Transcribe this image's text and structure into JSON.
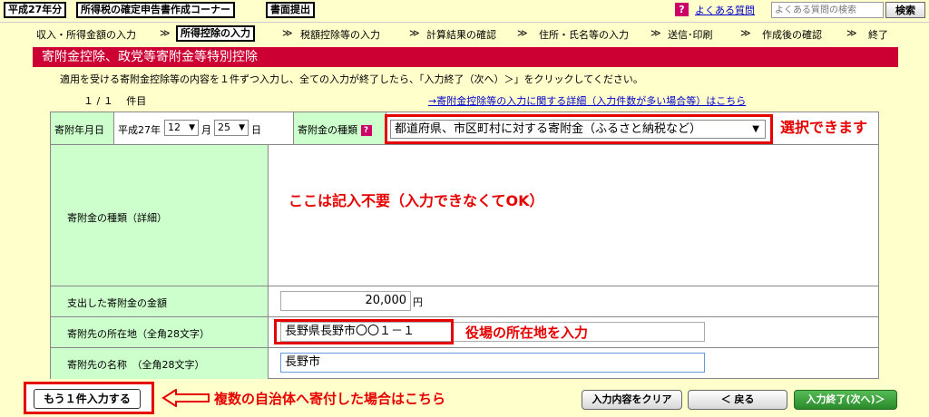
{
  "top": {
    "year_tag": "平成27年分",
    "corner_tag": "所得税の確定申告書作成コーナー",
    "paper_tag": "書面提出",
    "faq_icon": "?",
    "faq_link": "よくある質問",
    "faq_search_placeholder": "よくある質問の検索",
    "search_button": "検索"
  },
  "steps": [
    "収入・所得金額の入力",
    "所得控除の入力",
    "税額控除等の入力",
    "計算結果の確認",
    "住所・氏名等の入力",
    "送信･印刷",
    "作成後の確認",
    "終了"
  ],
  "step_separator": "≫",
  "section_title": "寄附金控除、政党等寄附金等特別控除",
  "instruction": "適用を受ける寄附金控除等の内容を１件ずつ入力し、全ての入力が終了したら、「入力終了（次へ）＞」をクリックしてください。",
  "record_count": "１ / １　 件目",
  "detail_link": "→寄附金控除等の入力に関する詳細（入力件数が多い場合等）はこちら",
  "form": {
    "date_label": "寄附年月日",
    "era": "平成27年",
    "month_value": "12",
    "month_unit": "月",
    "day_value": "25",
    "day_unit": "日",
    "type_label": "寄附金の種類",
    "type_help_icon": "?",
    "type_value": "都道府県、市区町村に対する寄附金（ふるさと納税など）",
    "type_detail_label": "寄附金の種類（詳細）",
    "amount_label": "支出した寄附金の金額",
    "amount_value": "20,000",
    "amount_unit": "円",
    "address_label": "寄附先の所在地（全角28文字）",
    "address_value": "長野県長野市〇〇１－１",
    "name_label": "寄附先の名称　（全角28文字）",
    "name_value": "長野市"
  },
  "annotations": {
    "selectable": "選択できます",
    "not_required": "ここは記入不要（入力できなくてOK）",
    "address_note": "役場の所在地を入力",
    "multiple_note": "複数の自治体へ寄付した場合はこちら"
  },
  "buttons": {
    "add_another": "もう１件入力する",
    "clear": "入力内容をクリア",
    "back": "＜ 戻る",
    "finish": "入力終了(次へ)＞"
  },
  "colors": {
    "background": "#ffffcc",
    "header_red": "#cc0033",
    "label_green": "#ccffcc",
    "annotation_red": "#e60000",
    "finish_green": "#339933"
  }
}
